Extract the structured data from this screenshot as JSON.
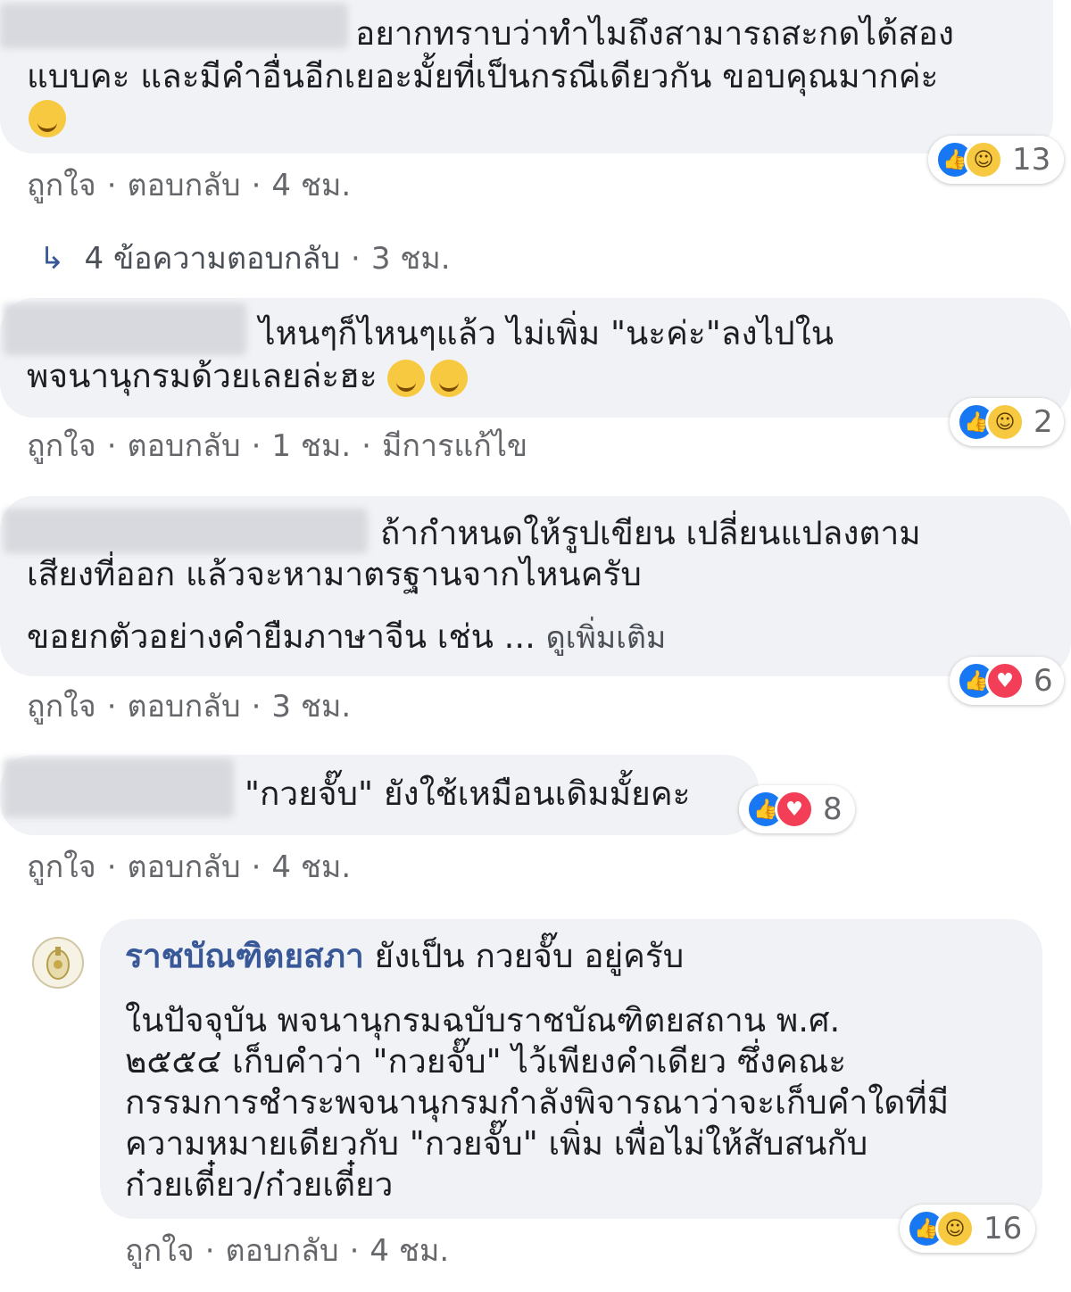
{
  "comments": [
    {
      "text_line1": "อยากทราบว่าทำไมถึงสามารถสะกดได้สอง",
      "text_line2": "แบบคะ และมีคำอื่นอีกเยอะมั้ยที่เป็นกรณีเดียวกัน ขอบคุณมากค่ะ",
      "like": "ถูกใจ",
      "reply": "ตอบกลับ",
      "time": "4 ชม.",
      "reaction_count": "13",
      "reactions": [
        "like-icon",
        "haha-icon"
      ],
      "replies_label": "4 ข้อความตอบกลับ",
      "replies_time": "3 ชม."
    },
    {
      "text_line1": "ไหนๆก็ไหนๆแล้ว ไม่เพิ่ม \"นะค่ะ\"ลงไปใน",
      "text_line2": "พจนานุกรมด้วยเลยล่ะฮะ",
      "like": "ถูกใจ",
      "reply": "ตอบกลับ",
      "time": "1 ชม.",
      "edited": "มีการแก้ไข",
      "reaction_count": "2",
      "reactions": [
        "like-icon",
        "haha-icon"
      ]
    },
    {
      "text_line1": "ถ้ากำหนดให้รูปเขียน เปลี่ยนแปลงตาม",
      "text_line2": "เสียงที่ออก แล้วจะหามาตรฐานจากไหนครับ",
      "text_line3": "ขอยกตัวอย่างคำยืมภาษาจีน เช่น ...",
      "see_more": "ดูเพิ่มเติม",
      "like": "ถูกใจ",
      "reply": "ตอบกลับ",
      "time": "3 ชม.",
      "reaction_count": "6",
      "reactions": [
        "like-icon",
        "love-icon"
      ]
    },
    {
      "text_line1": "\"กวยจั๊บ\" ยังใช้เหมือนเดิมมั้ยคะ",
      "like": "ถูกใจ",
      "reply": "ตอบกลับ",
      "time": "4 ชม.",
      "reaction_count": "8",
      "reactions": [
        "like-icon",
        "love-icon"
      ]
    }
  ],
  "reply": {
    "author": "ราชบัณฑิตยสภา",
    "headline_rest": "ยังเป็น กวยจั๊บ อยู่ครับ",
    "body_line1": "ในปัจจุบัน พจนานุกรมฉบับราชบัณฑิตยสถาน พ.ศ.",
    "body_line2": "๒๕๕๔ เก็บคำว่า \"กวยจั๊บ\" ไว้เพียงคำเดียว ซึ่งคณะ",
    "body_line3": "กรรมการชำระพจนานุกรมกำลังพิจารณาว่าจะเก็บคำใดที่มี",
    "body_line4": "ความหมายเดียวกับ \"กวยจั๊บ\" เพิ่ม เพื่อไม่ให้สับสนกับ",
    "body_line5": "ก๋วยเตี๋ยว/ก๋วยเตี๋ยว",
    "like": "ถูกใจ",
    "reply": "ตอบกลับ",
    "time": "4 ชม.",
    "reaction_count": "16",
    "reactions": [
      "like-icon",
      "haha-icon"
    ]
  },
  "separator": "·",
  "colors": {
    "bubble": "#f0f2f5",
    "like": "#1877f2",
    "haha": "#f7c940",
    "love": "#f33e58",
    "meta": "#65676b",
    "link": "#385898"
  }
}
